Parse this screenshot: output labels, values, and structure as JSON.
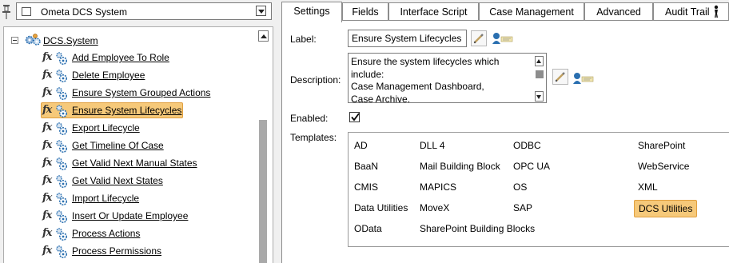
{
  "system_selector": {
    "value": "Ometa DCS System"
  },
  "tree": {
    "root": {
      "label": "DCS.System"
    },
    "items": [
      {
        "label": "Add Employee To Role",
        "selected": false
      },
      {
        "label": "Delete Employee",
        "selected": false
      },
      {
        "label": "Ensure System Grouped Actions",
        "selected": false
      },
      {
        "label": "Ensure System Lifecycles",
        "selected": true
      },
      {
        "label": "Export Lifecycle",
        "selected": false
      },
      {
        "label": "Get Timeline Of Case",
        "selected": false
      },
      {
        "label": "Get Valid Next Manual States",
        "selected": false
      },
      {
        "label": "Get Valid Next States",
        "selected": false
      },
      {
        "label": "Import Lifecycle",
        "selected": false
      },
      {
        "label": "Insert Or Update Employee",
        "selected": false
      },
      {
        "label": "Process Actions",
        "selected": false
      },
      {
        "label": "Process Permissions",
        "selected": false
      }
    ]
  },
  "tabs": [
    {
      "label": "Settings",
      "active": true
    },
    {
      "label": "Fields",
      "active": false
    },
    {
      "label": "Interface Script",
      "active": false
    },
    {
      "label": "Case Management",
      "active": false
    },
    {
      "label": "Advanced",
      "active": false
    },
    {
      "label": "Audit Trail",
      "active": false
    }
  ],
  "settings": {
    "label_caption": "Label:",
    "label_value": "Ensure System Lifecycles",
    "description_caption": "Description:",
    "description_value": "Ensure the system lifecycles which include:\nCase Management Dashboard,\nCase Archive,\nArchive Configuration Dashboard",
    "enabled_caption": "Enabled:",
    "enabled": true,
    "templates_caption": "Templates:"
  },
  "templates": [
    {
      "label": "AD",
      "selected": false
    },
    {
      "label": "DLL 4",
      "selected": false
    },
    {
      "label": "ODBC",
      "selected": false
    },
    {
      "label": "SharePoint",
      "selected": false
    },
    {
      "label": "BaaN",
      "selected": false
    },
    {
      "label": "Mail Building Block",
      "selected": false
    },
    {
      "label": "OPC UA",
      "selected": false
    },
    {
      "label": "WebService",
      "selected": false
    },
    {
      "label": "CMIS",
      "selected": false
    },
    {
      "label": "MAPICS",
      "selected": false
    },
    {
      "label": "OS",
      "selected": false
    },
    {
      "label": "XML",
      "selected": false
    },
    {
      "label": "Data Utilities",
      "selected": false
    },
    {
      "label": "MoveX",
      "selected": false
    },
    {
      "label": "SAP",
      "selected": false
    },
    {
      "label": "DCS Utilities",
      "selected": true
    },
    {
      "label": "OData",
      "selected": false
    },
    {
      "label": "SharePoint Building Blocks",
      "selected": false
    }
  ],
  "colors": {
    "selection_fill": "#f6c97a",
    "selection_border": "#e0a040",
    "gear_blue": "#2a6fb0"
  }
}
